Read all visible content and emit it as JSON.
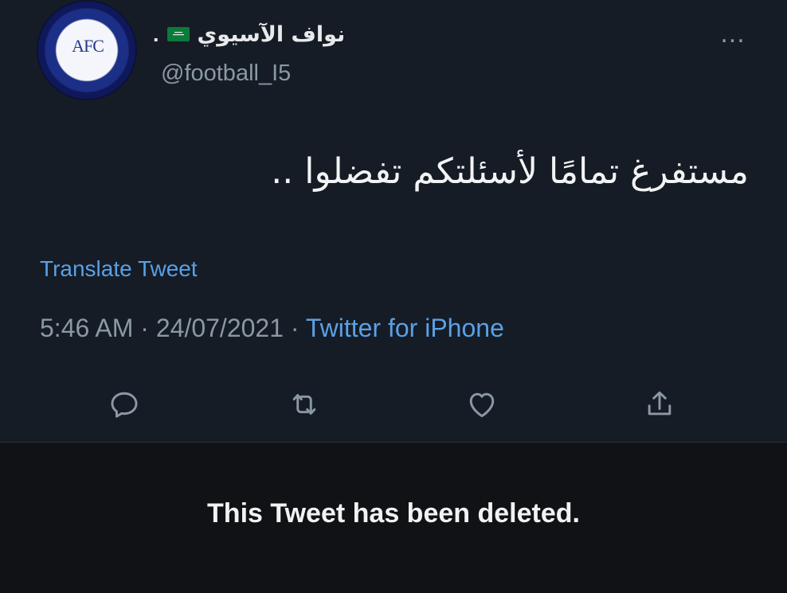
{
  "tweet": {
    "display_name": "نواف الآسيوي",
    "name_suffix": ".",
    "handle": "@football_I5",
    "more_label": "...",
    "text": "مستفرغ تمامًا لأسئلتكم تفضلوا ..",
    "translate_label": "Translate Tweet",
    "time": "5:46 AM",
    "date": "24/07/2021",
    "source": "Twitter for iPhone",
    "separator": "·",
    "avatar_text": "AFC",
    "icons": {
      "avatar": "afc-logo",
      "flag": "saudi-flag-icon",
      "reply": "reply-icon",
      "retweet": "retweet-icon",
      "like": "heart-icon",
      "share": "share-icon"
    },
    "colors": {
      "background": "#151c25",
      "text": "#e7e9ea",
      "muted": "#8b98a5",
      "link": "#5aa0e6"
    }
  },
  "deleted_notice": {
    "text": "This Tweet has been deleted."
  }
}
